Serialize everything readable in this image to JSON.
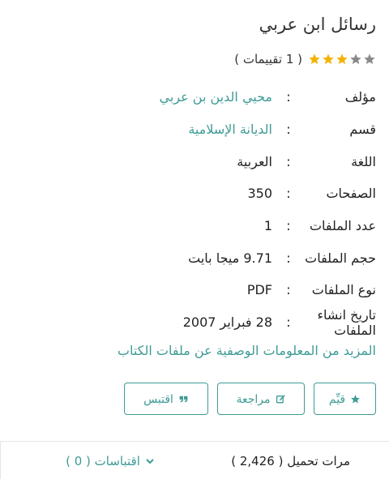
{
  "book": {
    "title": "رسائل ابن عربي"
  },
  "rating": {
    "stars_filled": 3,
    "stars_total": 5,
    "count_text": "( 1 تقييمات )",
    "colors": {
      "filled": "#f5b301",
      "empty": "#8a8a8a"
    }
  },
  "meta": {
    "colon": ":",
    "author": {
      "label": "مؤلف",
      "value": "محيي الدين بن عربي"
    },
    "category": {
      "label": "قسم",
      "value": "الديانة الإسلامية"
    },
    "language": {
      "label": "اللغة",
      "value": "العربية"
    },
    "pages": {
      "label": "الصفحات",
      "value": "350"
    },
    "file_count": {
      "label": "عدد الملفات",
      "value": "1"
    },
    "file_size": {
      "label": "حجم الملفات",
      "value": "9.71 ميجا بايت"
    },
    "file_type": {
      "label": "نوع الملفات",
      "value": "PDF"
    },
    "created": {
      "label": "تاريخ انشاء الملفات",
      "value": "28 فبراير 2007"
    }
  },
  "more_link": "المزيد من المعلومات الوصفية عن ملفات الكتاب",
  "actions": {
    "rate_label": "قيِّم",
    "review_label": "مراجعة",
    "quote_label": "اقتبس"
  },
  "footer": {
    "quotes_label": "اقتباسات ( 0 )",
    "downloads_label": "مرات تحميل",
    "downloads_count": "( 2,426 )"
  },
  "accent_color": "#3e9b95"
}
